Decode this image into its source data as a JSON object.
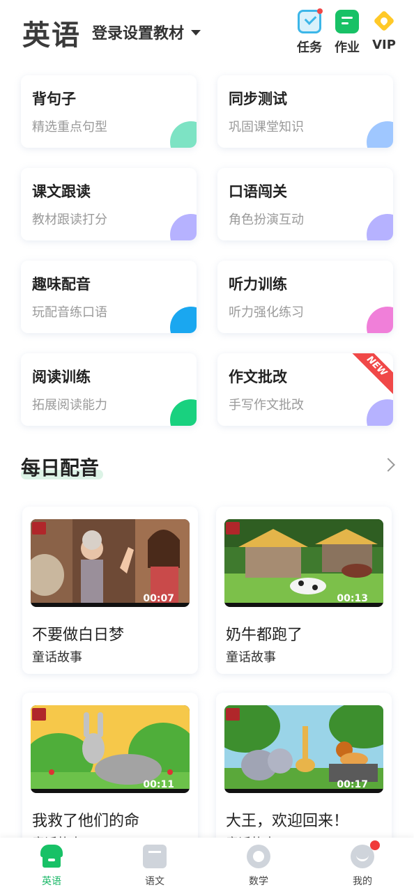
{
  "header": {
    "subject": "英语",
    "textbook_select": "登录设置教材",
    "actions": [
      {
        "label": "任务",
        "icon": "task-checklist-icon",
        "has_dot": true
      },
      {
        "label": "作业",
        "icon": "homework-icon",
        "has_dot": false
      },
      {
        "label": "VIP",
        "icon": "vip-diamond-icon",
        "has_dot": false
      }
    ]
  },
  "features": [
    {
      "title": "背句子",
      "subtitle": "精选重点句型",
      "accent": "#7de3c4"
    },
    {
      "title": "同步测试",
      "subtitle": "巩固课堂知识",
      "accent": "#9fc7ff"
    },
    {
      "title": "课文跟读",
      "subtitle": "教材跟读打分",
      "accent": "#b6b2ff"
    },
    {
      "title": "口语闯关",
      "subtitle": "角色扮演互动",
      "accent": "#b6b2ff"
    },
    {
      "title": "趣味配音",
      "subtitle": "玩配音练口语",
      "accent": "#1aa7f0"
    },
    {
      "title": "听力训练",
      "subtitle": "听力强化练习",
      "accent": "#f07fd9"
    },
    {
      "title": "阅读训练",
      "subtitle": "拓展阅读能力",
      "accent": "#19d17f"
    },
    {
      "title": "作文批改",
      "subtitle": "手写作文批改",
      "accent": "#b6b2ff",
      "badge": "NEW"
    }
  ],
  "daily_dubbing": {
    "title": "每日配音",
    "videos": [
      {
        "title": "不要做白日梦",
        "category": "童话故事",
        "duration": "00:07"
      },
      {
        "title": "奶牛都跑了",
        "category": "童话故事",
        "duration": "00:13"
      },
      {
        "title": "我救了他们的命",
        "category": "童话故事",
        "duration": "00:11"
      },
      {
        "title": "大王，欢迎回来！",
        "category": "童话故事",
        "duration": "00:17"
      }
    ]
  },
  "bottom_nav": [
    {
      "label": "英语",
      "icon": "english-home-icon",
      "active": true
    },
    {
      "label": "语文",
      "icon": "chinese-book-icon",
      "active": false
    },
    {
      "label": "数学",
      "icon": "math-icon",
      "active": false
    },
    {
      "label": "我的",
      "icon": "profile-icon",
      "active": false,
      "has_dot": true
    }
  ],
  "colors": {
    "brand_green": "#18c166",
    "badge_red": "#f04848"
  }
}
